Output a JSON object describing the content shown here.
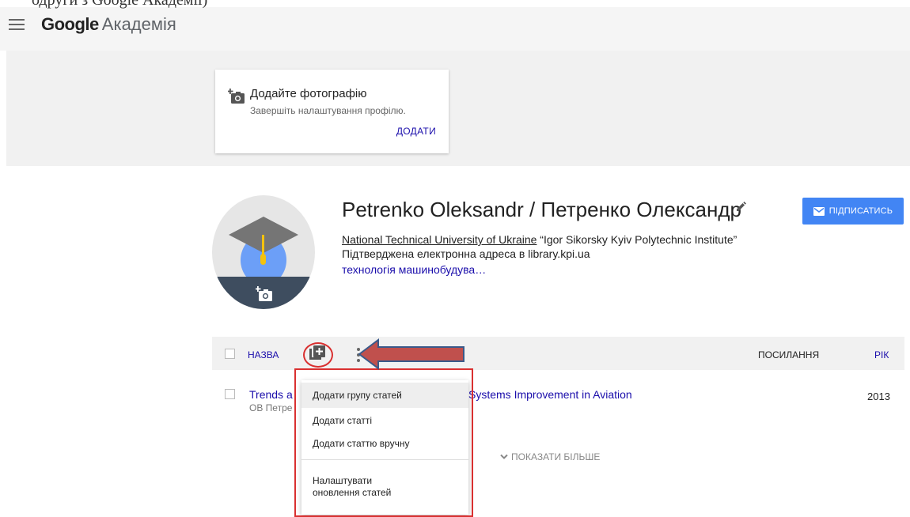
{
  "app": {
    "logo_google": "Google",
    "logo_product": "Академія"
  },
  "top_cut_text": "одруги з Google Академії)",
  "photo_card": {
    "title": "Додайте фотографію",
    "subtitle": "Завершіть налаштування профілю.",
    "action": "ДОДАТИ"
  },
  "profile": {
    "name": "Petrenko Oleksandr / Петренко Олександр",
    "affiliation_link": "National Technical University of Ukraine",
    "affiliation_rest": " “Igor Sikorsky Kyiv Polytechnic Institute”",
    "email": "Підтверджена електронна адреса в library.kpi.ua",
    "interests": "технологія машинобудува…",
    "follow": "ПІДПИСАТИСЬ"
  },
  "table": {
    "col_title": "НАЗВА",
    "col_cites": "ПОСИЛАННЯ",
    "col_year": "РІК",
    "rows": [
      {
        "title_start": "Trends a",
        "title_end": "Systems Improvement in Aviation",
        "authors": "ОВ Петре",
        "year": "2013"
      }
    ],
    "show_more": "ПОКАЗАТИ БІЛЬШЕ"
  },
  "dropdown": {
    "items": [
      "Додати групу статей",
      "Додати статті",
      "Додати статтю вручну"
    ],
    "settings_line1": "Налаштувати",
    "settings_line2": "оновлення статей"
  },
  "colors": {
    "accent": "#4285f4",
    "link": "#1a0dab",
    "annotation": "#d93030",
    "arrow_fill": "#c0504d",
    "arrow_stroke": "#3a5a8a"
  }
}
